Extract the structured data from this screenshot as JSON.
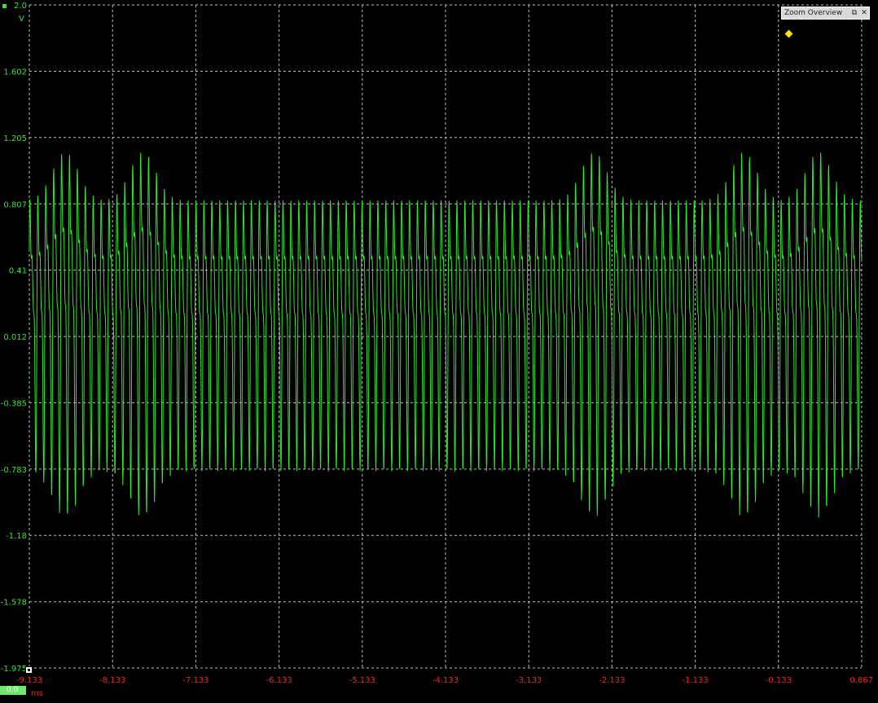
{
  "app": {
    "zoom_overview_title": "Zoom Overview",
    "zoom_overview_restore_icon": "restore-icon",
    "zoom_overview_close_icon": "close-icon",
    "restore_glyph": "⧉",
    "close_glyph": "✕"
  },
  "channel": {
    "color": "#2fe52f",
    "unit_label": "V",
    "offset_value": "0.0"
  },
  "time_axis": {
    "unit_label": "ms",
    "color": "#e32b2b"
  },
  "chart_data": {
    "type": "line",
    "title": "",
    "xlabel": "ms",
    "ylabel": "V",
    "xlim": [
      -9.133,
      0.867
    ],
    "ylim": [
      -1.975,
      2.0
    ],
    "grid": true,
    "x_ticks": [
      "-9.133",
      "-8.133",
      "-7.133",
      "-6.133",
      "-5.133",
      "-4.133",
      "-3.133",
      "-2.133",
      "-1.133",
      "-0.133",
      "0.867"
    ],
    "y_ticks": [
      "2.0",
      "1.602",
      "1.205",
      "0.807",
      "0.41",
      "0.012",
      "-0.385",
      "-0.783",
      "-1.18",
      "-1.578",
      "-1.975"
    ],
    "series": [
      {
        "color": "#2fe52f",
        "carrier_period_ms": 0.095,
        "typical_max_v": 1.2,
        "typical_min_v": -0.85,
        "peak_max_v": 1.53,
        "peak_min_v": -1.22,
        "burst_centers_ms": [
          -8.7,
          -7.77,
          -2.35,
          -0.55,
          0.35
        ]
      }
    ]
  }
}
